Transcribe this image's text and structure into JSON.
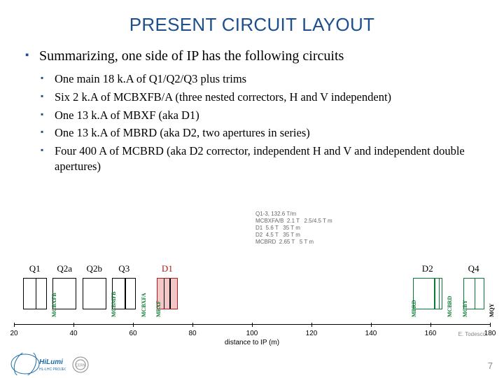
{
  "title": "PRESENT CIRCUIT LAYOUT",
  "body": {
    "summary": "Summarizing, one side of IP has the following circuits",
    "items": [
      "One main 18 k.A of Q1/Q2/Q3 plus trims",
      "Six 2 k.A of MCBXFB/A (three nested correctors, H and V independent)",
      "One 13 k.A of MBXF (aka D1)",
      "One 13 k.A of MBRD (aka D2, two apertures in series)",
      "Four 400 A of MCBRD (aka D2 corrector, independent H and V and independent double apertures)"
    ]
  },
  "chart_data": {
    "type": "table",
    "title": "",
    "xlabel": "distance to IP (m)",
    "ylabel": "",
    "xlim": [
      20,
      180
    ],
    "x_ticks": [
      20,
      40,
      60,
      80,
      100,
      120,
      140,
      160,
      180
    ],
    "elements": [
      {
        "name": "Q1",
        "start": 23,
        "end": 31,
        "color": "black",
        "splits": [
          27
        ]
      },
      {
        "name": "Q2a",
        "start": 33,
        "end": 41,
        "color": "black",
        "splits": []
      },
      {
        "name": "Q2b",
        "start": 43,
        "end": 51,
        "color": "black",
        "splits": []
      },
      {
        "name": "Q3",
        "start": 53,
        "end": 61,
        "color": "black",
        "splits": [
          57
        ]
      },
      {
        "name": "D1",
        "start": 68,
        "end": 75,
        "color": "red",
        "splits": [
          70,
          72
        ]
      },
      {
        "name": "D2",
        "start": 154,
        "end": 164,
        "color": "green",
        "splits": [
          161,
          162.5
        ],
        "label_color": "black"
      },
      {
        "name": "Q4",
        "start": 171,
        "end": 178,
        "color": "green",
        "splits": [
          174.5
        ]
      }
    ],
    "correctors": [
      {
        "name": "MCBXFB",
        "x": 32,
        "color": "green"
      },
      {
        "name": "MCBMFB",
        "x": 52,
        "color": "green"
      },
      {
        "name": "MCBXFA",
        "x": 62,
        "color": "green"
      },
      {
        "name": "MBXF",
        "x": 67,
        "color": "green"
      },
      {
        "name": "MBRD",
        "x": 153,
        "color": "green"
      },
      {
        "name": "MCBRD",
        "x": 165,
        "color": "green"
      },
      {
        "name": "MCBY",
        "x": 170,
        "color": "green"
      },
      {
        "name": "MQY",
        "x": 179,
        "color": "black"
      }
    ],
    "legend_lines": [
      "Q1-3, 132.6 T/m",
      "MCBXFA/B  2.1 T   2.5/4.5 T m",
      "D1  5.6 T   35 T m",
      "D2  4.5 T   35 T m",
      "MCBRD  2.65 T   5 T m"
    ],
    "signature": "E. Todesco"
  },
  "footer": {
    "page": "7",
    "logo_hilumi": "HiLumi HL-LHC PROJECT",
    "logo_cern": "CERN"
  }
}
